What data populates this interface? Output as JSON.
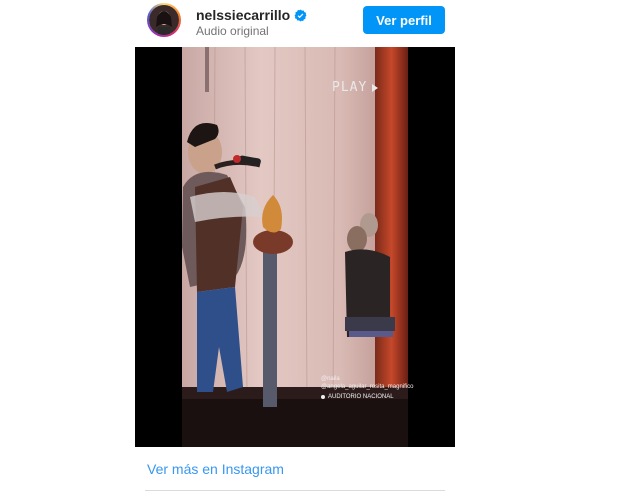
{
  "header": {
    "username": "nelssiecarrillo",
    "subtitle": "Audio original",
    "view_profile_label": "Ver perfil",
    "verified_icon": "verified-badge-icon"
  },
  "media": {
    "overlay_play_text": "PLAY",
    "tag_user": "@naila",
    "tag_account": "@angela_aguilar_rosita_magnifico",
    "location": "AUDITORIO NACIONAL"
  },
  "footer": {
    "link_label": "Ver más en Instagram"
  },
  "colors": {
    "primary_button": "#0095f6",
    "link": "#3897f0",
    "username": "#262626",
    "subtitle": "#737373"
  }
}
